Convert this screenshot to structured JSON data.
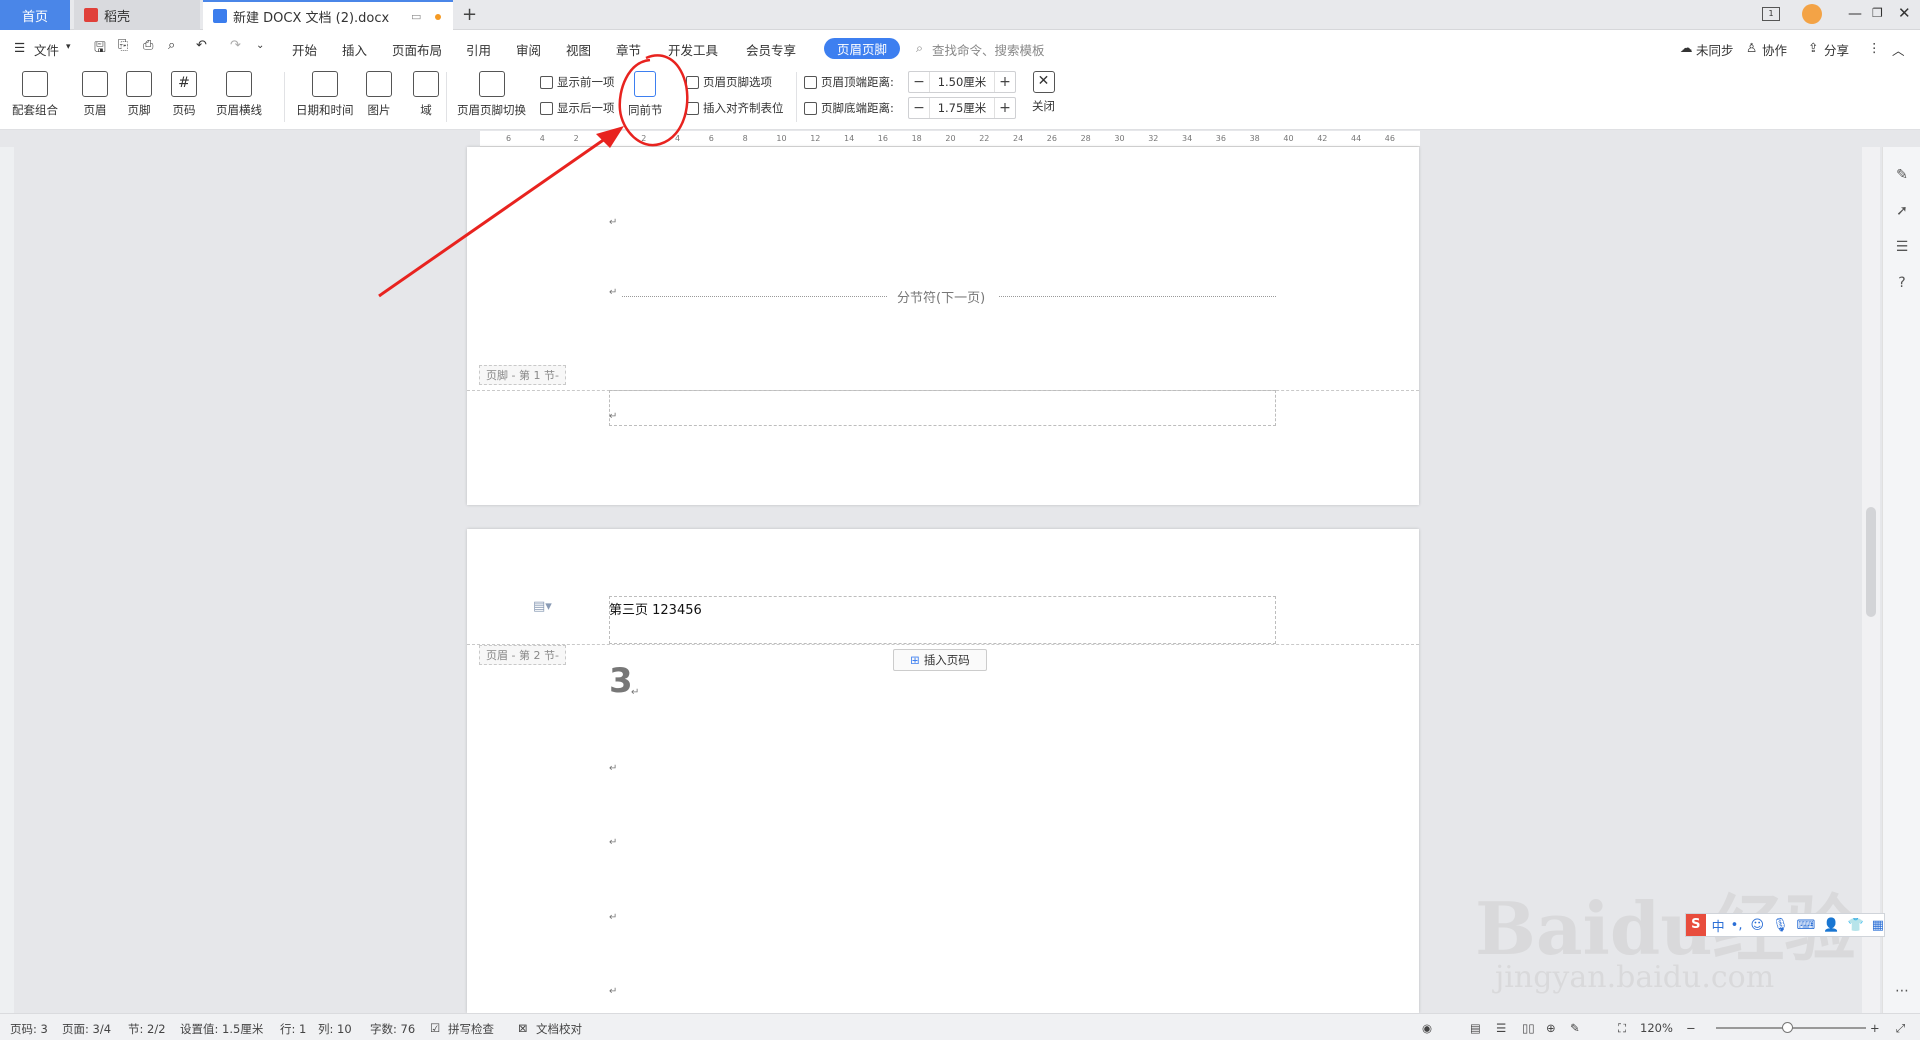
{
  "tabs": {
    "home": "首页",
    "docer": "稻壳",
    "document": "新建 DOCX 文档 (2).docx",
    "new_tab": "+"
  },
  "menu": {
    "file": "文件",
    "items": [
      "开始",
      "插入",
      "页面布局",
      "引用",
      "审阅",
      "视图",
      "章节",
      "开发工具",
      "会员专享"
    ],
    "active_tab": "页眉页脚",
    "search_placeholder": "查找命令、搜索模板",
    "sync": "未同步",
    "collab": "协作",
    "share": "分享"
  },
  "ribbon": {
    "combo": "配套组合",
    "header": "页眉",
    "footer": "页脚",
    "page_number": "页码",
    "header_line": "页眉横线",
    "datetime": "日期和时间",
    "picture": "图片",
    "field": "域",
    "switch": "页眉页脚切换",
    "show_prev": "显示前一项",
    "show_next": "显示后一项",
    "same_as_prev": "同前节",
    "options": "页眉页脚选项",
    "insert_tab": "插入对齐制表位",
    "header_dist_label": "页眉顶端距离:",
    "header_dist_value": "1.50厘米",
    "footer_dist_label": "页脚底端距离:",
    "footer_dist_value": "1.75厘米",
    "close": "关闭",
    "minus": "−",
    "plus": "+"
  },
  "ruler": {
    "ticks": [
      "6",
      "4",
      "2",
      "",
      "2",
      "4",
      "6",
      "8",
      "10",
      "12",
      "14",
      "16",
      "18",
      "20",
      "22",
      "24",
      "26",
      "28",
      "30",
      "32",
      "34",
      "36",
      "38",
      "40",
      "42",
      "44",
      "46"
    ]
  },
  "page1": {
    "section_break": "分节符(下一页)",
    "footer_label": "页脚 - 第 1 节-",
    "para_mark": "↵"
  },
  "page2": {
    "header_text": "第三页 123456",
    "header_label": "页眉 - 第 2 节-",
    "insert_page_number": "插入页码",
    "page_digit": "3",
    "para_mark": "↵"
  },
  "status": {
    "page_code": "页码: 3",
    "page": "页面: 3/4",
    "section": "节: 2/2",
    "setting": "设置值: 1.5厘米",
    "row": "行: 1",
    "col": "列: 10",
    "words": "字数: 76",
    "spell": "拼写检查",
    "proof": "文档校对",
    "zoom": "120%"
  },
  "ime": {
    "lang": "中"
  },
  "watermark": {
    "line1": "Baidu经验",
    "line2": "jingyan.baidu.com"
  },
  "colors": {
    "accent": "#3d7ff0",
    "annotation": "#e8231f"
  }
}
